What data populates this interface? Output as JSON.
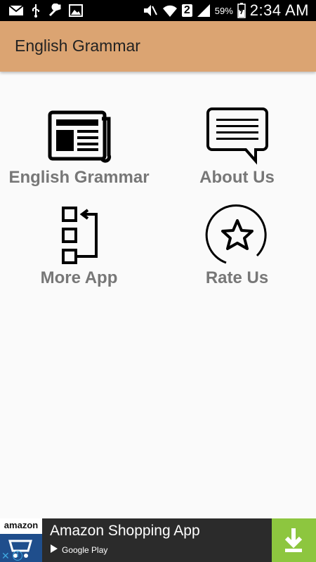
{
  "status_bar": {
    "left_icons": [
      "mail-icon",
      "usb-icon",
      "wrench-icon",
      "image-icon"
    ],
    "right_icons": [
      "mute-icon",
      "wifi-icon",
      "sim-icon",
      "signal-icon",
      "battery-icon"
    ],
    "sim_number": "2",
    "battery_percent": "59%",
    "time": "2:34 AM"
  },
  "app_bar": {
    "title": "English Grammar",
    "color": "#dba472"
  },
  "tiles": [
    {
      "label": "English Grammar",
      "icon": "newspaper-icon"
    },
    {
      "label": "About Us",
      "icon": "speech-bubble-icon"
    },
    {
      "label": "More App",
      "icon": "more-apps-icon"
    },
    {
      "label": "Rate Us",
      "icon": "star-circle-icon"
    }
  ],
  "ad": {
    "brand": "amazon",
    "title": "Amazon Shopping App",
    "store": "Google Play",
    "accent_color": "#8dc63f"
  }
}
